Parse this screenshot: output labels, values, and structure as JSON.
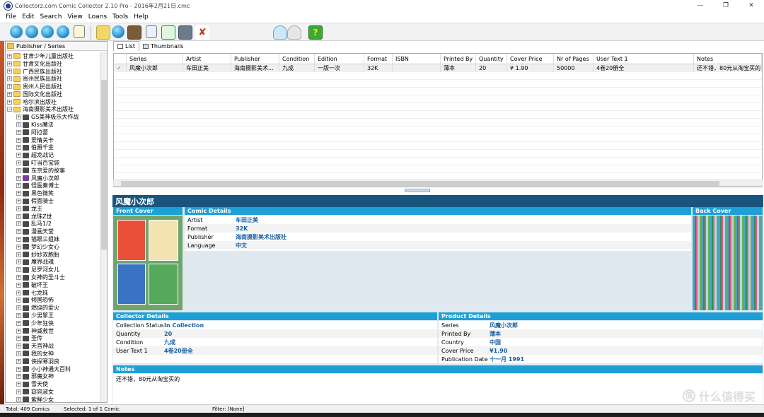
{
  "window": {
    "title": "Collectorz.com Comic Collector 2.10 Pro - 2016年2月21日.cmc",
    "controls": [
      "—",
      "❐",
      "✕"
    ]
  },
  "menu": [
    "File",
    "Edit",
    "Search",
    "View",
    "Loans",
    "Tools",
    "Help"
  ],
  "sidebar": {
    "header": "Publisher / Series",
    "publishers": [
      "甘肃少年儿童出版社",
      "甘肃文化出版社",
      "广西民族出版社",
      "贵州民族出版社",
      "贵州人民出版社",
      "国际文化出版社",
      "哈尔滨出版社",
      "海南摄影美术出版社"
    ],
    "series": [
      "GS美神极乐大作战",
      "Kiss魔法",
      "阿拉蕾",
      "爱情关卡",
      "伯爵千金",
      "超龙战记",
      "叮当百宝袋",
      "东京爱的故事",
      "风魔小次郎",
      "怪医秦博士",
      "黑色微笑",
      "假面骑士",
      "龙王",
      "龙珠Z世",
      "乱马1/2",
      "漫画天堂",
      "猫眼三姐妹",
      "梦幻少女心",
      "妙妙双胞胎",
      "魔界战魂",
      "尼罗河女儿",
      "女神的圣斗士",
      "破坏王",
      "七龙珠",
      "倾国恐怖",
      "燃烧的爱火",
      "少男擎王",
      "少年狂侠",
      "神威救世",
      "圣传",
      "天宫神战",
      "我的女神",
      "侠探寒羽良",
      "小小神通大百科",
      "邪魔女神",
      "雪天使",
      "窈窕淑女",
      "紫眸少女"
    ]
  },
  "tabs": [
    "List",
    "Thumbnails"
  ],
  "list": {
    "columns": [
      "Series",
      "Artist",
      "Publisher",
      "Condition",
      "Edition",
      "Format",
      "ISBN",
      "Printed By",
      "Quantity",
      "Cover Price",
      "Nr of Pages",
      "User Text 1",
      "Notes"
    ],
    "rows": [
      [
        "风魔小次郎",
        "车田正美",
        "海南摄影美术...",
        "九成",
        "一版一次",
        "32K",
        "",
        "薄本",
        "20",
        "¥ 1.90",
        "50000",
        "4卷20册全",
        "还不错，80元从淘宝买的"
      ]
    ]
  },
  "detail": {
    "title": "风魔小次郎",
    "front_cover_label": "Front Cover",
    "back_cover_label": "Back Cover",
    "comic_details_label": "Comic Details",
    "comic_details": [
      {
        "k": "Artist",
        "v": "车田正美"
      },
      {
        "k": "Format",
        "v": "32K"
      },
      {
        "k": "Publisher",
        "v": "海南摄影美术出版社"
      },
      {
        "k": "Language",
        "v": "中文"
      }
    ],
    "collector_details_label": "Collector Details",
    "collector_details": [
      {
        "k": "Collection Status",
        "v": "In Collection"
      },
      {
        "k": "Quantity",
        "v": "20"
      },
      {
        "k": "Condition",
        "v": "九成"
      },
      {
        "k": "User Text 1",
        "v": "4卷20册全"
      }
    ],
    "product_details_label": "Product Details",
    "product_details": [
      {
        "k": "Series",
        "v": "风魔小次郎"
      },
      {
        "k": "Printed By",
        "v": "薄本"
      },
      {
        "k": "Country",
        "v": "中国"
      },
      {
        "k": "Cover Price",
        "v": "¥1.90"
      },
      {
        "k": "Publication Date",
        "v": "十一月 1991"
      }
    ],
    "notes_label": "Notes",
    "notes": "还不错，80元从淘宝买的"
  },
  "status": {
    "total": "Total: 409 Comics",
    "selected": "Selected: 1 of 1 Comic",
    "filter": "Filter: [None]"
  },
  "watermark": {
    "badge": "值",
    "text": "什么值得买"
  }
}
